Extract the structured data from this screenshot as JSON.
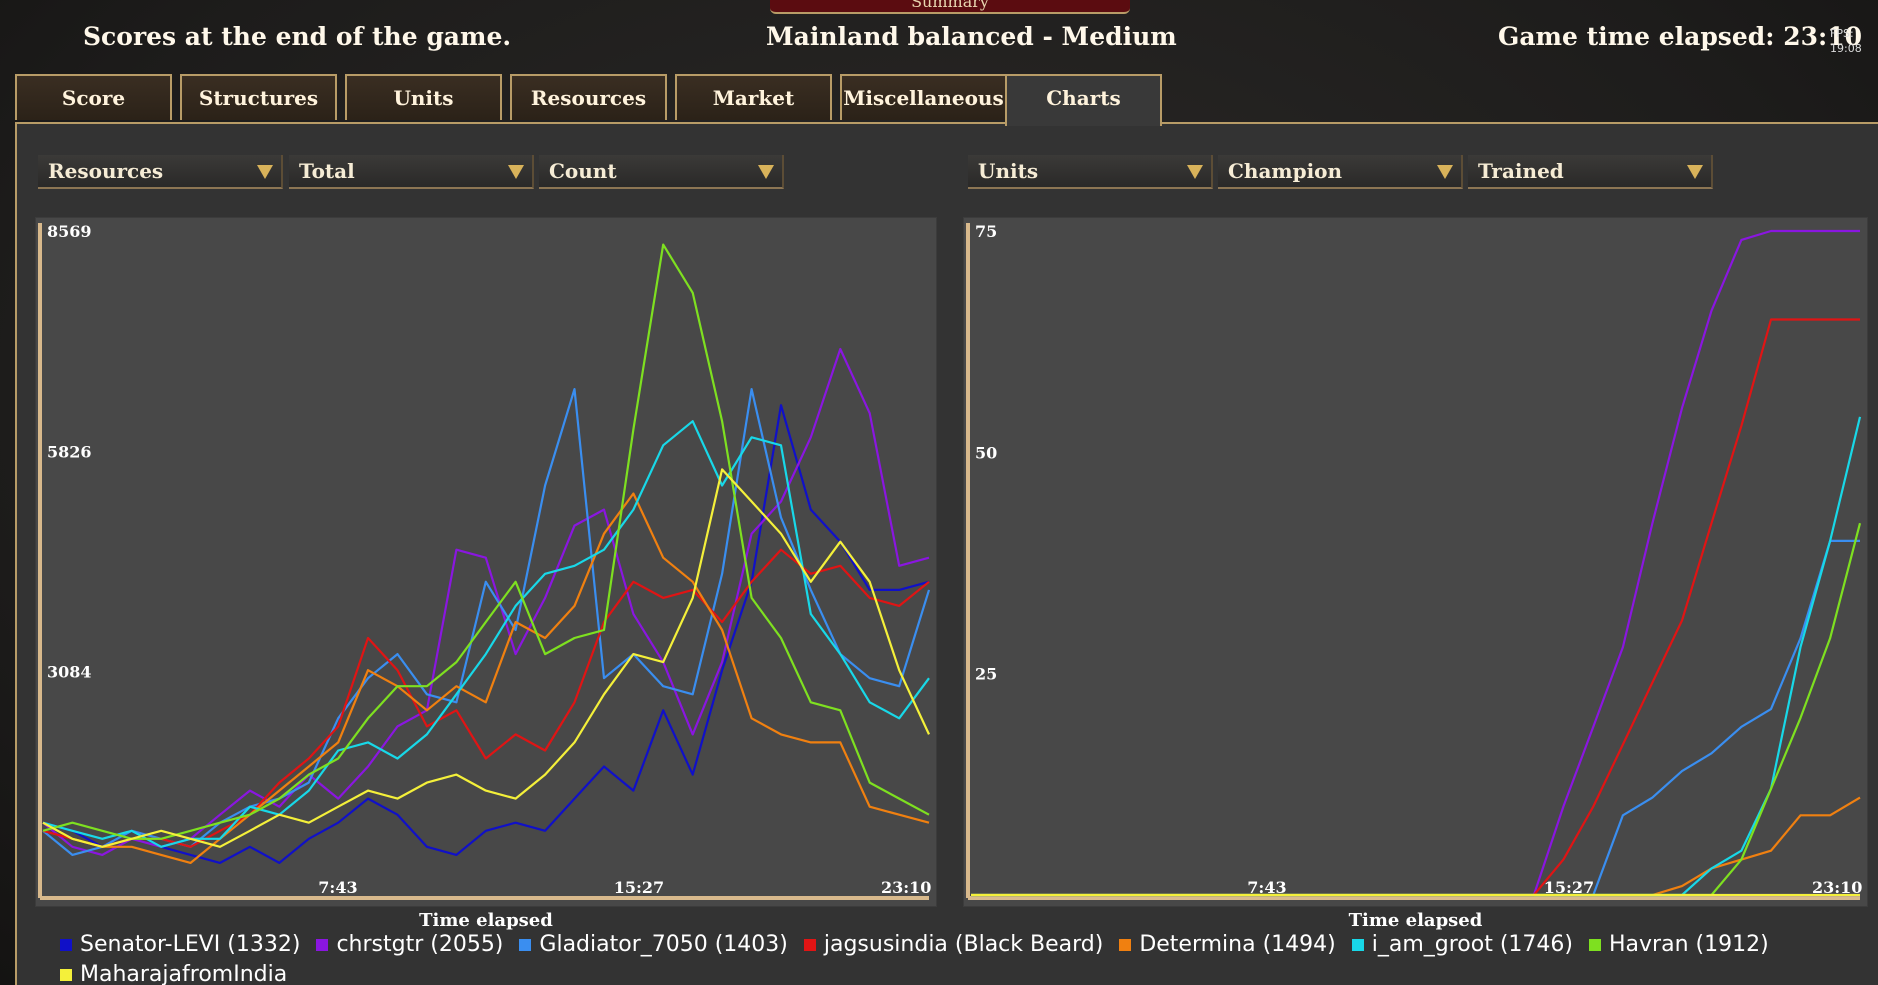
{
  "window": {
    "banner": "Summary",
    "left_text": "Scores at the end of the game.",
    "center_text": "Mainland balanced - Medium",
    "right_text": "Game time elapsed: 23:10",
    "fps_label": "FPS:",
    "clock": "19:08"
  },
  "tabs": [
    {
      "label": "Score"
    },
    {
      "label": "Structures"
    },
    {
      "label": "Units"
    },
    {
      "label": "Resources"
    },
    {
      "label": "Market"
    },
    {
      "label": "Miscellaneous"
    },
    {
      "label": "Charts",
      "active": true
    }
  ],
  "left_chart": {
    "dropdowns": [
      "Resources",
      "Total",
      "Count"
    ],
    "xlabel": "Time elapsed"
  },
  "right_chart": {
    "dropdowns": [
      "Units",
      "Champion",
      "Trained"
    ],
    "xlabel": "Time elapsed"
  },
  "legend": [
    {
      "name": "Senator-LEVI (1332)",
      "color": "#1010c8"
    },
    {
      "name": "chrstgtr (2055)",
      "color": "#8a16e0"
    },
    {
      "name": "Gladiator_7050 (1403)",
      "color": "#3a8ef0"
    },
    {
      "name": "jagsusindia (Black Beard)",
      "color": "#e01414"
    },
    {
      "name": "Determina (1494)",
      "color": "#f08010"
    },
    {
      "name": "i_am_groot (1746)",
      "color": "#18d8e8"
    },
    {
      "name": "Havran (1912)",
      "color": "#7ee020"
    },
    {
      "name": "MaharajafromIndia",
      "color": "#f4f03a"
    }
  ],
  "chart_data": [
    {
      "type": "line",
      "title": "",
      "xlabel": "Time elapsed",
      "ylabel": "",
      "x_ticks": [
        "7:43",
        "15:27",
        "23:10"
      ],
      "y_ticks": [
        3084,
        5826,
        8569
      ],
      "xlim": [
        0,
        23.17
      ],
      "ylim": [
        300,
        8569
      ],
      "x": [
        0,
        0.77,
        1.55,
        2.32,
        3.09,
        3.86,
        4.63,
        5.41,
        6.18,
        6.95,
        7.72,
        8.5,
        9.27,
        10.04,
        10.81,
        11.58,
        12.36,
        13.13,
        13.9,
        14.67,
        15.44,
        16.22,
        16.99,
        17.76,
        18.53,
        19.3,
        20.08,
        20.85,
        21.62,
        22.39,
        23.17
      ],
      "series": [
        {
          "name": "Senator-LEVI (1332)",
          "color": "#1010c8",
          "values": [
            1200,
            1100,
            900,
            1100,
            900,
            800,
            700,
            900,
            700,
            1000,
            1200,
            1500,
            1300,
            900,
            800,
            1100,
            1200,
            1100,
            1500,
            1900,
            1600,
            2600,
            1800,
            3100,
            4200,
            6400,
            5100,
            4700,
            4100,
            4100,
            4200
          ]
        },
        {
          "name": "chrstgtr (2055)",
          "color": "#8a16e0",
          "values": [
            1200,
            900,
            800,
            1000,
            900,
            1000,
            1300,
            1600,
            1400,
            1800,
            1500,
            1900,
            2400,
            2600,
            4600,
            4500,
            3300,
            4000,
            4900,
            5100,
            3800,
            3200,
            2300,
            3200,
            4800,
            5200,
            6000,
            7100,
            6300,
            4400,
            4500
          ]
        },
        {
          "name": "Gladiator_7050 (1403)",
          "color": "#3a8ef0",
          "values": [
            1100,
            800,
            900,
            1100,
            1000,
            900,
            1200,
            1400,
            1500,
            1700,
            2500,
            3000,
            3300,
            2800,
            2700,
            4200,
            3600,
            5400,
            6600,
            3000,
            3300,
            2900,
            2800,
            4300,
            6600,
            5000,
            4100,
            3300,
            3000,
            2900,
            4100
          ]
        },
        {
          "name": "jagsusindia (Black Beard)",
          "color": "#e01414",
          "values": [
            1100,
            1000,
            900,
            1000,
            1000,
            900,
            1100,
            1300,
            1700,
            2000,
            2400,
            3500,
            3100,
            2400,
            2600,
            2000,
            2300,
            2100,
            2700,
            3700,
            4200,
            4000,
            4100,
            3700,
            4200,
            4600,
            4300,
            4400,
            4000,
            3900,
            4200
          ]
        },
        {
          "name": "Determina (1494)",
          "color": "#f08010",
          "values": [
            1200,
            1000,
            900,
            900,
            800,
            700,
            1000,
            1300,
            1600,
            1900,
            2200,
            3100,
            2900,
            2600,
            2900,
            2700,
            3700,
            3500,
            3900,
            4800,
            5300,
            4500,
            4200,
            3600,
            2500,
            2300,
            2200,
            2200,
            1400,
            1300,
            1200
          ]
        },
        {
          "name": "i_am_groot (1746)",
          "color": "#18d8e8",
          "values": [
            1200,
            1100,
            1000,
            1100,
            900,
            1000,
            1000,
            1400,
            1300,
            1600,
            2100,
            2200,
            2000,
            2300,
            2800,
            3300,
            3900,
            4300,
            4400,
            4600,
            5100,
            5900,
            6200,
            5400,
            6000,
            5900,
            3800,
            3300,
            2700,
            2500,
            3000
          ]
        },
        {
          "name": "Havran (1912)",
          "color": "#7ee020",
          "values": [
            1100,
            1200,
            1100,
            1000,
            1000,
            1100,
            1200,
            1300,
            1500,
            1800,
            2000,
            2500,
            2900,
            2900,
            3200,
            3700,
            4200,
            3300,
            3500,
            3600,
            6100,
            8400,
            7800,
            6200,
            4000,
            3500,
            2700,
            2600,
            1700,
            1500,
            1300
          ]
        },
        {
          "name": "MaharajafromIndia",
          "color": "#f4f03a",
          "values": [
            1200,
            1000,
            900,
            1000,
            1100,
            1000,
            900,
            1100,
            1300,
            1200,
            1400,
            1600,
            1500,
            1700,
            1800,
            1600,
            1500,
            1800,
            2200,
            2800,
            3300,
            3200,
            4000,
            5600,
            5200,
            4800,
            4200,
            4700,
            4200,
            3100,
            2300
          ]
        }
      ]
    },
    {
      "type": "line",
      "title": "",
      "xlabel": "Time elapsed",
      "ylabel": "",
      "x_ticks": [
        "7:43",
        "15:27",
        "23:10"
      ],
      "y_ticks": [
        25,
        50,
        75
      ],
      "xlim": [
        0,
        23.17
      ],
      "ylim": [
        0,
        75
      ],
      "x": [
        0,
        0.77,
        1.55,
        2.32,
        3.09,
        3.86,
        4.63,
        5.41,
        6.18,
        6.95,
        7.72,
        8.5,
        9.27,
        10.04,
        10.81,
        11.58,
        12.36,
        13.13,
        13.9,
        14.67,
        15.44,
        16.22,
        16.99,
        17.76,
        18.53,
        19.3,
        20.08,
        20.85,
        21.62,
        22.39,
        23.17
      ],
      "series": [
        {
          "name": "Senator-LEVI (1332)",
          "color": "#1010c8",
          "values": [
            0,
            0,
            0,
            0,
            0,
            0,
            0,
            0,
            0,
            0,
            0,
            0,
            0,
            0,
            0,
            0,
            0,
            0,
            0,
            0,
            0,
            0,
            0,
            0,
            0,
            0,
            0,
            0,
            0,
            0,
            0
          ]
        },
        {
          "name": "chrstgtr (2055)",
          "color": "#8a16e0",
          "values": [
            0,
            0,
            0,
            0,
            0,
            0,
            0,
            0,
            0,
            0,
            0,
            0,
            0,
            0,
            0,
            0,
            0,
            0,
            0,
            0,
            10,
            19,
            28,
            42,
            55,
            66,
            74,
            75,
            75,
            75,
            75
          ]
        },
        {
          "name": "Gladiator_7050 (1403)",
          "color": "#3a8ef0",
          "values": [
            0,
            0,
            0,
            0,
            0,
            0,
            0,
            0,
            0,
            0,
            0,
            0,
            0,
            0,
            0,
            0,
            0,
            0,
            0,
            0,
            0,
            0,
            9,
            11,
            14,
            16,
            19,
            21,
            29,
            40,
            40
          ]
        },
        {
          "name": "jagsusindia (Black Beard)",
          "color": "#e01414",
          "values": [
            0,
            0,
            0,
            0,
            0,
            0,
            0,
            0,
            0,
            0,
            0,
            0,
            0,
            0,
            0,
            0,
            0,
            0,
            0,
            0,
            4,
            10,
            17,
            24,
            31,
            42,
            53,
            65,
            65,
            65,
            65
          ]
        },
        {
          "name": "Determina (1494)",
          "color": "#f08010",
          "values": [
            0,
            0,
            0,
            0,
            0,
            0,
            0,
            0,
            0,
            0,
            0,
            0,
            0,
            0,
            0,
            0,
            0,
            0,
            0,
            0,
            0,
            0,
            0,
            0,
            1,
            3,
            4,
            5,
            9,
            9,
            11
          ]
        },
        {
          "name": "i_am_groot (1746)",
          "color": "#18d8e8",
          "values": [
            0,
            0,
            0,
            0,
            0,
            0,
            0,
            0,
            0,
            0,
            0,
            0,
            0,
            0,
            0,
            0,
            0,
            0,
            0,
            0,
            0,
            0,
            0,
            0,
            0,
            3,
            5,
            12,
            28,
            40,
            54
          ]
        },
        {
          "name": "Havran (1912)",
          "color": "#7ee020",
          "values": [
            0,
            0,
            0,
            0,
            0,
            0,
            0,
            0,
            0,
            0,
            0,
            0,
            0,
            0,
            0,
            0,
            0,
            0,
            0,
            0,
            0,
            0,
            0,
            0,
            0,
            0,
            4,
            12,
            20,
            29,
            42
          ]
        },
        {
          "name": "MaharajafromIndia",
          "color": "#f4f03a",
          "values": [
            0,
            0,
            0,
            0,
            0,
            0,
            0,
            0,
            0,
            0,
            0,
            0,
            0,
            0,
            0,
            0,
            0,
            0,
            0,
            0,
            0,
            0,
            0,
            0,
            0,
            0,
            0,
            0,
            0,
            0,
            0
          ]
        }
      ]
    }
  ]
}
